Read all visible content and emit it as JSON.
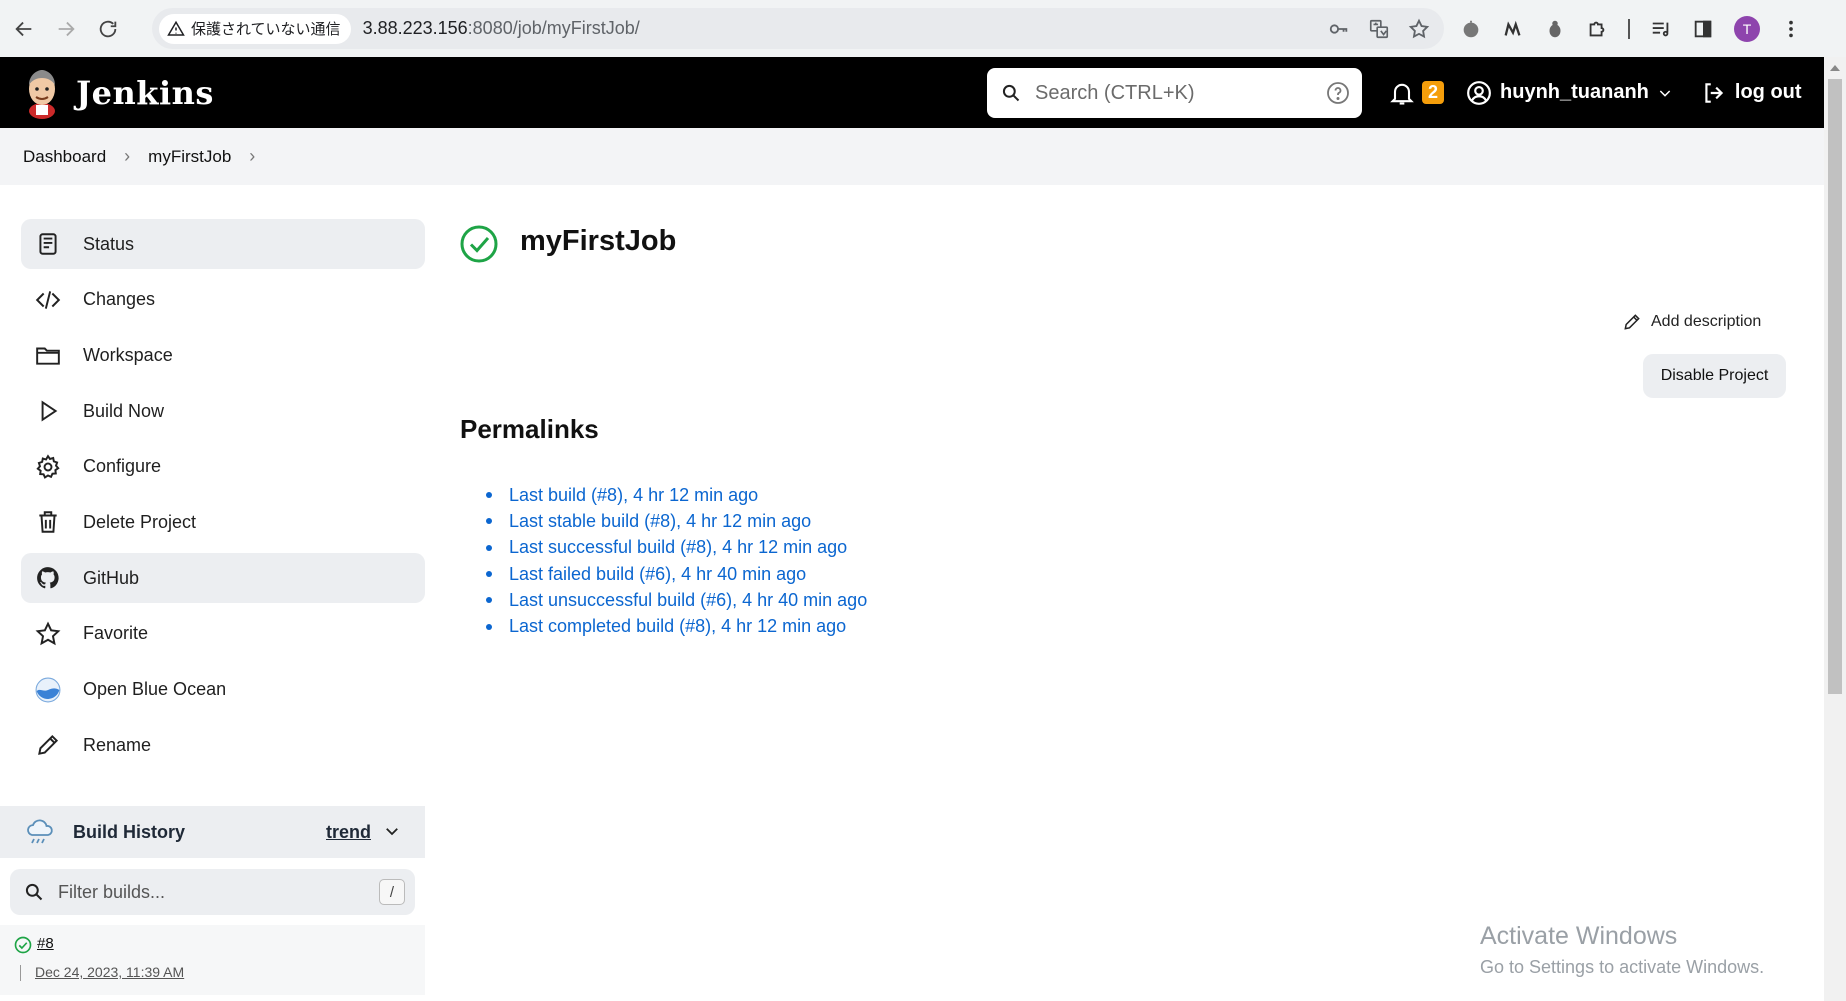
{
  "browser": {
    "security_label": "保護されていない通信",
    "url_host": "3.88.223.156",
    "url_rest": ":8080/job/myFirstJob/",
    "profile_initial": "T"
  },
  "header": {
    "app_title": "Jenkins",
    "search_placeholder": "Search (CTRL+K)",
    "notification_count": "2",
    "username": "huynh_tuananh",
    "logout_label": "log out"
  },
  "breadcrumb": {
    "items": [
      "Dashboard",
      "myFirstJob"
    ]
  },
  "sidebar": {
    "items": [
      {
        "label": "Status",
        "icon": "status-icon"
      },
      {
        "label": "Changes",
        "icon": "code-icon"
      },
      {
        "label": "Workspace",
        "icon": "folder-icon"
      },
      {
        "label": "Build Now",
        "icon": "play-icon"
      },
      {
        "label": "Configure",
        "icon": "gear-icon"
      },
      {
        "label": "Delete Project",
        "icon": "trash-icon"
      },
      {
        "label": "GitHub",
        "icon": "github-icon"
      },
      {
        "label": "Favorite",
        "icon": "star-icon"
      },
      {
        "label": "Open Blue Ocean",
        "icon": "blue-ocean-icon"
      },
      {
        "label": "Rename",
        "icon": "pencil-icon"
      }
    ]
  },
  "build_history": {
    "title": "Build History",
    "trend_label": "trend",
    "filter_placeholder": "Filter builds...",
    "filter_shortcut": "/",
    "builds": [
      {
        "number": "#8",
        "date": "Dec 24, 2023, 11:39 AM",
        "status": "success"
      }
    ]
  },
  "main": {
    "job_title": "myFirstJob",
    "add_description_label": "Add description",
    "disable_project_label": "Disable Project",
    "permalinks_title": "Permalinks",
    "permalinks": [
      "Last build (#8), 4 hr 12 min ago",
      "Last stable build (#8), 4 hr 12 min ago",
      "Last successful build (#8), 4 hr 12 min ago",
      "Last failed build (#6), 4 hr 40 min ago",
      "Last unsuccessful build (#6), 4 hr 40 min ago",
      "Last completed build (#8), 4 hr 12 min ago"
    ]
  },
  "watermark": {
    "line1": "Activate Windows",
    "line2": "Go to Settings to activate Windows."
  },
  "colors": {
    "link": "#0b66d0",
    "success": "#1ea446",
    "badge": "#f59e0b",
    "header_bg": "#000000"
  }
}
